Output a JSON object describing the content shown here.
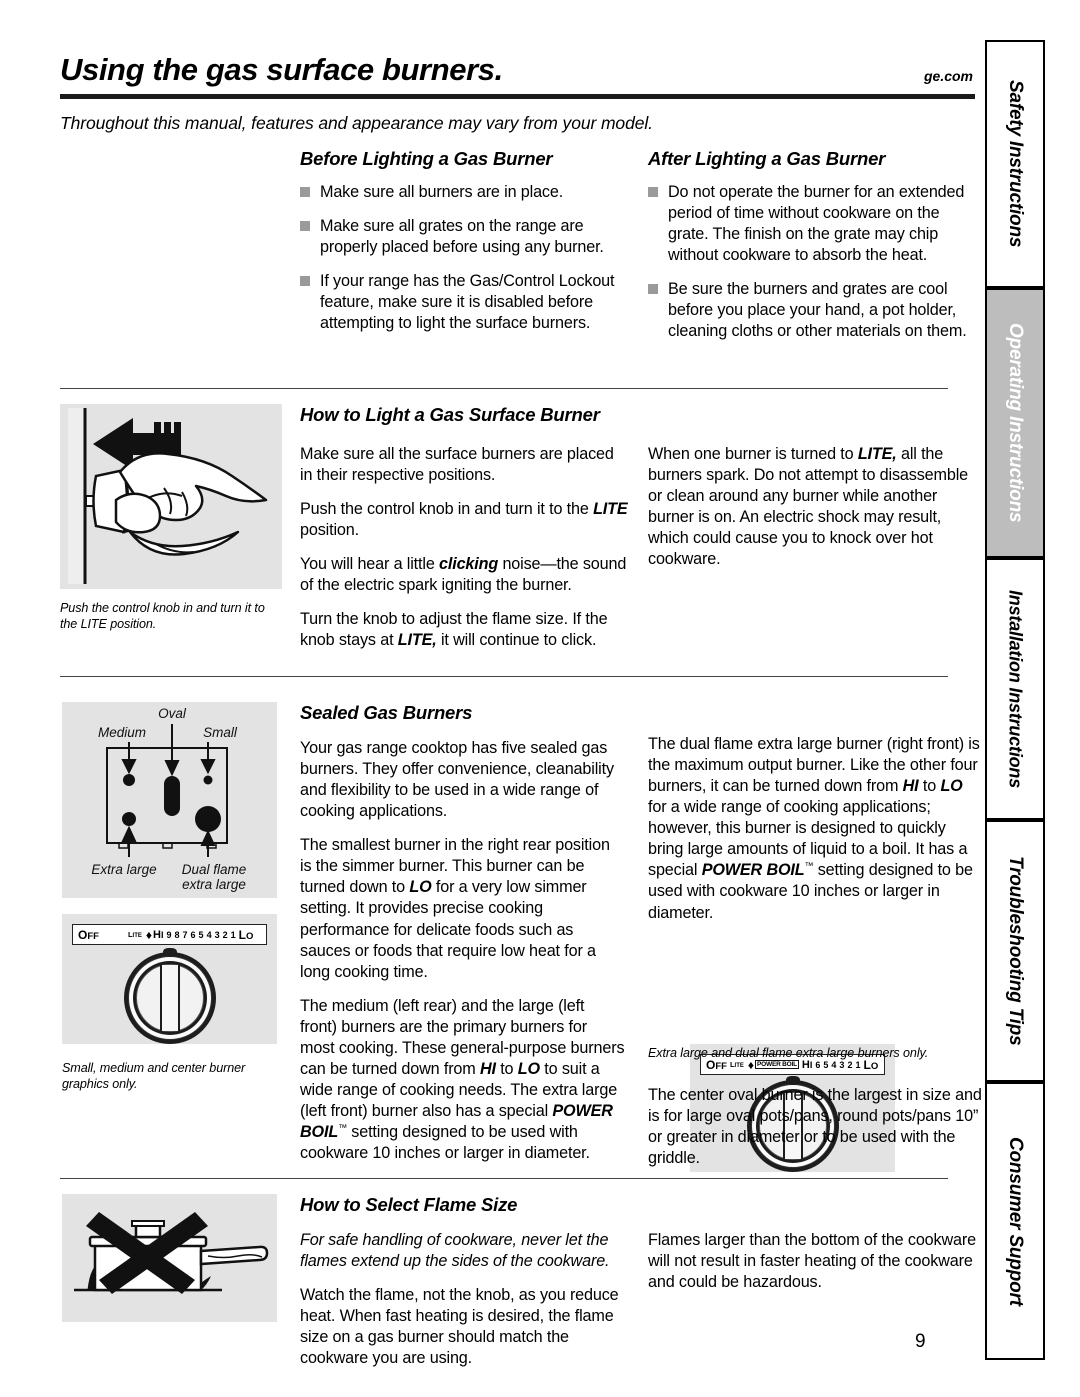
{
  "header": {
    "title": "Using the gas surface burners.",
    "site": "ge.com",
    "intro": "Throughout this manual, features and appearance may vary from your model."
  },
  "before_lighting": {
    "heading": "Before Lighting a Gas Burner",
    "bullets": [
      "Make sure all burners are in place.",
      "Make sure all grates on the range are properly placed before using any burner.",
      "If your range has the Gas/Control Lockout feature, make sure it is disabled before attempting to light the surface burners."
    ]
  },
  "after_lighting": {
    "heading": "After Lighting a Gas Burner",
    "bullets": [
      "Do not operate the burner for an extended period of time without cookware on the grate. The finish on the grate may chip without cookware to absorb the heat.",
      "Be sure the burners and grates are cool before you place your hand, a pot holder, cleaning cloths or other materials on them."
    ]
  },
  "how_to_light": {
    "heading": "How to Light a Gas Surface Burner",
    "left_paragraphs": [
      "Make sure all the surface burners are placed in their respective positions.",
      "Push the control knob in and turn it to the LITE position.",
      "You will hear a little clicking noise—the sound of the electric spark igniting the burner.",
      "Turn the knob to adjust the flame size. If the knob stays at LITE, it will continue to click."
    ],
    "right_paragraphs": [
      "When one burner is turned to LITE, all the burners spark. Do not attempt to disassemble or clean around any burner while another burner is on. An electric shock may result, which could cause you to knock over hot cookware."
    ],
    "illustration_caption": "Push the control knob in and turn it to the LITE position."
  },
  "sealed_burners": {
    "heading": "Sealed Gas Burners",
    "left_paragraphs": [
      "Your gas range cooktop has five sealed gas burners. They offer convenience, cleanability and flexibility to be used in a wide range of cooking applications.",
      "The smallest burner in the right rear position is the simmer burner. This burner can be turned down to LO for a very low simmer setting. It provides precise cooking performance for delicate foods such as sauces or foods that require low heat for a long cooking time.",
      "The medium (left rear) and the large (left front) burners are the primary burners for most cooking. These general-purpose burners can be turned down from HI to LO to suit a wide range of cooking needs. The extra large (left front) burner also has a special POWER BOIL setting designed to be used with cookware 10 inches or larger in diameter."
    ],
    "right_paragraphs": [
      "The dual flame extra large burner (right front) is the maximum output burner. Like the other four burners, it can be turned down from HI to LO for a wide range of cooking applications; however, this burner is designed to quickly bring large amounts of liquid to a boil. It has a special POWER BOIL setting designed to be used with cookware 10 inches or larger in diameter.",
      "The center oval burner is the largest in size and is for large oval pots/pans, round pots/pans 10” or greater in diameter or to be used with the griddle."
    ],
    "cooktop_diagram": {
      "labels_top": [
        "Medium",
        "Oval",
        "Small"
      ],
      "labels_bottom": [
        "Extra large",
        "Dual flame extra large"
      ]
    },
    "left_knob": {
      "caption": "Small, medium and center burner graphics only.",
      "settings": [
        "OFF",
        "LITE",
        "HI",
        "9",
        "8",
        "7",
        "6",
        "5",
        "4",
        "3",
        "2",
        "1",
        "LO"
      ]
    },
    "right_knob": {
      "caption": "Extra large and dual flame extra large burners only.",
      "settings": [
        "OFF",
        "LITE",
        "POWER BOIL",
        "HI",
        "6",
        "5",
        "4",
        "3",
        "2",
        "1",
        "LO"
      ]
    }
  },
  "flame_size": {
    "heading": "How to Select Flame Size",
    "left_paragraphs": [
      "For safe handling of cookware, never let the flames extend up the sides of the cookware.",
      "Watch the flame, not the knob, as you reduce heat. When fast heating is desired, the flame size on a gas burner should match the cookware you are using."
    ],
    "right_paragraphs": [
      "Flames larger than the bottom of the cookware will not result in faster heating of the cookware and could be hazardous."
    ]
  },
  "side_tabs": [
    {
      "label": "Safety Instructions",
      "active": false
    },
    {
      "label": "Operating Instructions",
      "active": true
    },
    {
      "label": "Installation Instructions",
      "active": false
    },
    {
      "label": "Troubleshooting Tips",
      "active": false
    },
    {
      "label": "Consumer Support",
      "active": false
    }
  ],
  "page_number": "9"
}
